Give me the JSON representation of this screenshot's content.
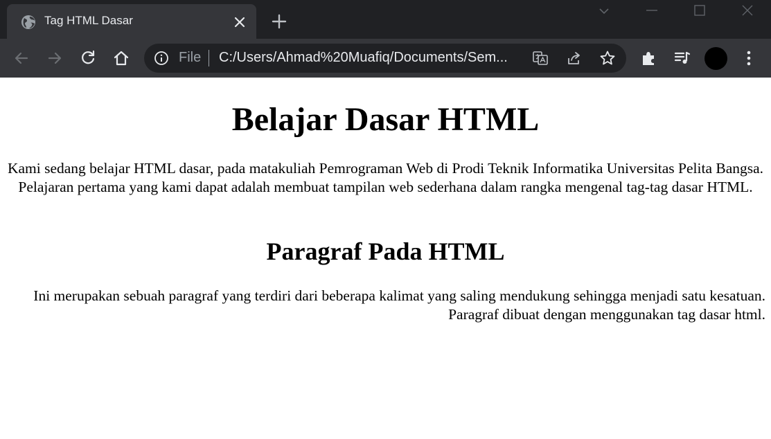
{
  "browser": {
    "tab": {
      "title": "Tag HTML Dasar",
      "favicon": "globe-icon"
    },
    "address_bar": {
      "scheme_label": "File",
      "url": "C:/Users/Ahmad%20Muafiq/Documents/Sem..."
    },
    "colors": {
      "tabstrip_bg": "#202124",
      "toolbar_bg": "#35363a",
      "icon": "#e8eaed",
      "icon_disabled": "#9aa0a6"
    }
  },
  "page": {
    "heading": "Belajar Dasar HTML",
    "intro_paragraph": "Kami sedang belajar HTML dasar, pada matakuliah Pemrograman Web di Prodi Teknik Informatika Universitas Pelita Bangsa. Pelajaran pertama yang kami dapat adalah membuat tampilan web sederhana dalam rangka mengenal tag-tag dasar HTML.",
    "subheading": "Paragraf Pada HTML",
    "body_paragraph": "Ini merupakan sebuah paragraf yang terdiri dari beberapa kalimat yang saling mendukung sehingga menjadi satu kesatuan. Paragraf dibuat dengan menggunakan tag dasar html."
  }
}
